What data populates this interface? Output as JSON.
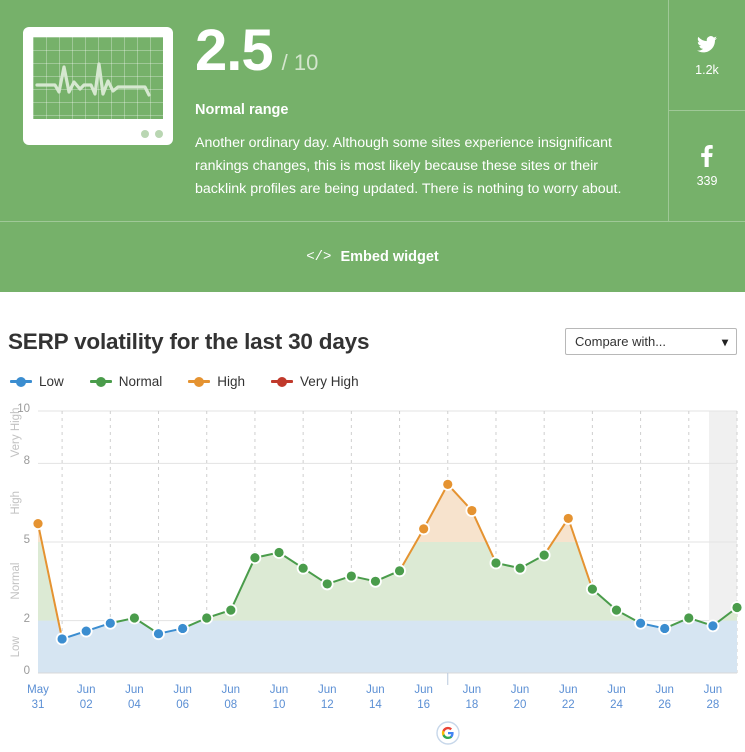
{
  "hero": {
    "icon_name": "heart-monitor-icon",
    "score_value": "2.5",
    "score_max": "/ 10",
    "range_label": "Normal range",
    "description": "Another ordinary day. Although some sites experience insignificant rankings changes, this is most likely because these sites or their backlink profiles are being updated. There is nothing to worry about.",
    "background_color": "#76b16a",
    "social": [
      {
        "icon": "twitter-icon",
        "count": "1.2k"
      },
      {
        "icon": "facebook-icon",
        "count": "339"
      }
    ],
    "embed": {
      "code_glyph": "</>",
      "label": "Embed widget"
    }
  },
  "chart_header": {
    "title": "SERP volatility for the last 30 days",
    "compare_select": {
      "value": "Compare with...",
      "chevron": "chevron-down-icon"
    }
  },
  "legend": [
    {
      "label": "Low",
      "color": "#3b8dd0"
    },
    {
      "label": "Normal",
      "color": "#4a9c4b"
    },
    {
      "label": "High",
      "color": "#e59331"
    },
    {
      "label": "Very High",
      "color": "#c0392b"
    }
  ],
  "chart_data": {
    "type": "line",
    "title": "SERP volatility for the last 30 days",
    "xlabel": "",
    "ylabel": "",
    "ylim": [
      0,
      10
    ],
    "yticks": [
      0,
      2,
      5,
      8,
      10
    ],
    "grid": true,
    "legend_position": "top-left",
    "band_labels": [
      {
        "name": "Low",
        "range": [
          0,
          2
        ],
        "color": "#3b8dd0"
      },
      {
        "name": "Normal",
        "range": [
          2,
          5
        ],
        "color": "#4a9c4b"
      },
      {
        "name": "High",
        "range": [
          5,
          8
        ],
        "color": "#e59331"
      },
      {
        "name": "Very High",
        "range": [
          8,
          10
        ],
        "color": "#c0392b"
      }
    ],
    "x_tick_labels": [
      "May\n31",
      "Jun\n02",
      "Jun\n04",
      "Jun\n06",
      "Jun\n08",
      "Jun\n10",
      "Jun\n12",
      "Jun\n14",
      "Jun\n16",
      "Jun\n18",
      "Jun\n20",
      "Jun\n22",
      "Jun\n24",
      "Jun\n26",
      "Jun\n28"
    ],
    "x": [
      "May 31",
      "Jun 01",
      "Jun 02",
      "Jun 03",
      "Jun 04",
      "Jun 05",
      "Jun 06",
      "Jun 07",
      "Jun 08",
      "Jun 09",
      "Jun 10",
      "Jun 11",
      "Jun 12",
      "Jun 13",
      "Jun 14",
      "Jun 15",
      "Jun 16",
      "Jun 17",
      "Jun 18",
      "Jun 19",
      "Jun 20",
      "Jun 21",
      "Jun 22",
      "Jun 23",
      "Jun 24",
      "Jun 25",
      "Jun 26",
      "Jun 27",
      "Jun 28"
    ],
    "values": [
      5.7,
      1.3,
      1.6,
      1.9,
      2.1,
      1.5,
      1.7,
      2.1,
      2.4,
      4.4,
      4.6,
      4.0,
      3.4,
      3.7,
      3.5,
      3.9,
      5.5,
      7.2,
      6.2,
      4.2,
      4.0,
      4.5,
      5.9,
      3.2,
      2.4,
      1.9,
      1.7,
      2.1,
      1.8,
      2.5
    ],
    "point_colors": [
      "#e59331",
      "#3b8dd0",
      "#3b8dd0",
      "#3b8dd0",
      "#4a9c4b",
      "#3b8dd0",
      "#3b8dd0",
      "#4a9c4b",
      "#4a9c4b",
      "#4a9c4b",
      "#4a9c4b",
      "#4a9c4b",
      "#4a9c4b",
      "#4a9c4b",
      "#4a9c4b",
      "#4a9c4b",
      "#e59331",
      "#e59331",
      "#e59331",
      "#4a9c4b",
      "#4a9c4b",
      "#4a9c4b",
      "#e59331",
      "#4a9c4b",
      "#4a9c4b",
      "#3b8dd0",
      "#3b8dd0",
      "#4a9c4b",
      "#3b8dd0",
      "#4a9c4b"
    ],
    "today_marker": {
      "label": "google-update-marker",
      "x": "Jun 16"
    },
    "highlight_last_column": true
  }
}
